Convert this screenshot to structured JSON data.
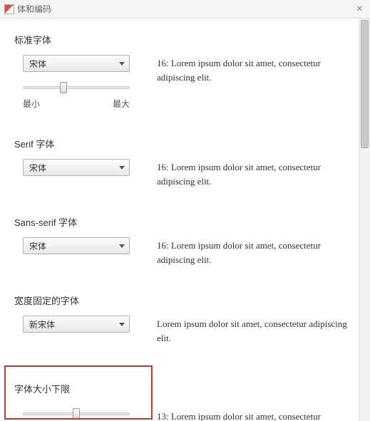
{
  "window": {
    "title": "体和编码",
    "close": "×"
  },
  "sections": {
    "standard": {
      "title": "标准字体",
      "font": "宋体",
      "sample": "16: Lorem ipsum dolor sit amet, consectetur adipiscing elit.",
      "slider_min": "最小",
      "slider_max": "最大"
    },
    "serif": {
      "title": "Serif 字体",
      "font": "宋体",
      "sample": "16: Lorem ipsum dolor sit amet, consectetur adipiscing elit."
    },
    "sansserif": {
      "title": "Sans-serif 字体",
      "font": "宋体",
      "sample": "16: Lorem ipsum dolor sit amet, consectetur adipiscing elit."
    },
    "fixed": {
      "title": "宽度固定的字体",
      "font": "新宋体",
      "sample": "Lorem ipsum dolor sit amet, consectetur adipiscing elit."
    },
    "minsize": {
      "title": "字体大小下限",
      "sample": "13: Lorem ipsum dolor sit amet, consectetur"
    }
  }
}
